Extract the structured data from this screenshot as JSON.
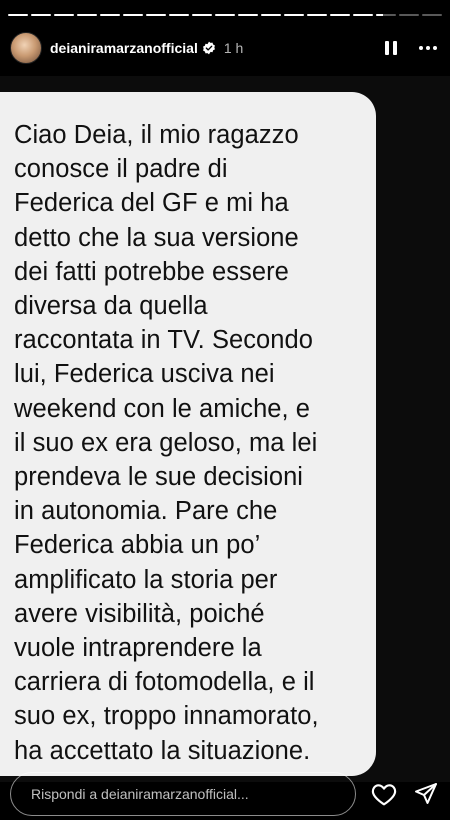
{
  "story": {
    "progress_segments": [
      1,
      1,
      1,
      1,
      1,
      1,
      1,
      1,
      1,
      1,
      1,
      1,
      1,
      1,
      1,
      1,
      0.35,
      0,
      0
    ],
    "username": "deianiramarzanofficial",
    "timestamp": "1 h",
    "verified": true
  },
  "message": {
    "lines": [
      "Ciao Deia, il mio ragazzo",
      "conosce il padre di",
      "Federica del GF e mi ha",
      "detto che la sua versione",
      "dei fatti potrebbe essere",
      "diversa da quella",
      "raccontata in TV. Secondo",
      "lui, Federica usciva nei",
      "weekend con le amiche, e",
      "il suo ex era geloso, ma lei",
      "prendeva le sue decisioni",
      "in autonomia. Pare che",
      "Federica abbia un po’",
      "amplificato la storia per",
      "avere visibilità, poiché",
      "vuole intraprendere la",
      "carriera di fotomodella, e il",
      "suo ex, troppo innamorato,",
      "ha accettato la situazione."
    ]
  },
  "reply": {
    "placeholder": "Rispondi a deianiramarzanofficial..."
  },
  "icons": {
    "verified": "verified-badge-icon",
    "pause": "pause-icon",
    "more": "more-options-icon",
    "heart": "heart-icon",
    "send": "send-icon"
  },
  "colors": {
    "background": "#000000",
    "bubble": "#f0f0f0",
    "text": "#111111"
  }
}
